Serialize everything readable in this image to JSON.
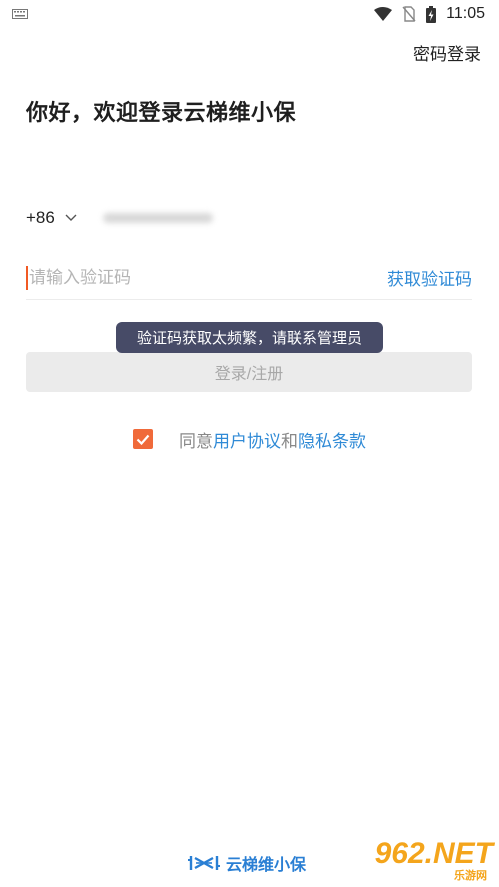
{
  "status_bar": {
    "time": "11:05",
    "icons": [
      "keyboard-icon",
      "wifi-icon",
      "no-sim-icon",
      "battery-charging-icon"
    ]
  },
  "header": {
    "password_login_label": "密码登录"
  },
  "main": {
    "title": "你好，欢迎登录云梯维小保",
    "country_code": "+86",
    "code_placeholder": "请输入验证码",
    "get_code_label": "获取验证码",
    "toast": "验证码获取太频繁，请联系管理员",
    "login_button_label": "登录/注册",
    "agreement": {
      "checked": true,
      "prefix": "同意",
      "user_agreement": "用户协议",
      "conjunction": "和",
      "privacy_terms": "隐私条款"
    }
  },
  "footer": {
    "brand_name": "云梯维小保"
  },
  "watermark": {
    "main": "962.NET",
    "sub": "乐游网"
  },
  "colors": {
    "accent_orange": "#f06a3a",
    "link_blue": "#2f8ad6",
    "toast_bg": "#474b67",
    "disabled_button_bg": "#ebebeb"
  }
}
